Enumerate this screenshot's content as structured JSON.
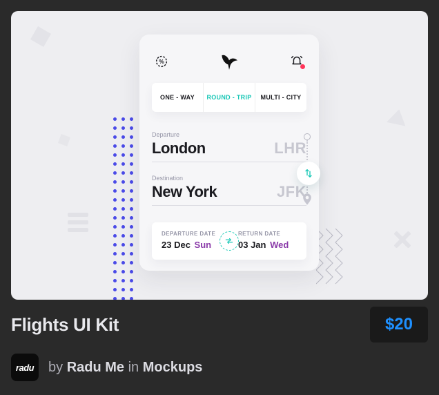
{
  "app": {
    "tabs": [
      {
        "label": "ONE - WAY",
        "active": false
      },
      {
        "label": "ROUND - TRIP",
        "active": true
      },
      {
        "label": "MULTI - CITY",
        "active": false
      }
    ],
    "departure": {
      "label": "Departure",
      "city": "London",
      "code": "LHR"
    },
    "destination": {
      "label": "Destination",
      "city": "New York",
      "code": "JFK"
    },
    "dates": {
      "dep_label": "DEPARTURE DATE",
      "dep_date": "23 Dec",
      "dep_dow": "Sun",
      "ret_label": "RETURN DATE",
      "ret_date": "03 Jan",
      "ret_dow": "Wed"
    }
  },
  "product": {
    "title": "Flights UI Kit",
    "price": "$20",
    "avatar_text": "radu",
    "by_text": "by",
    "author": "Radu Me",
    "in_text": "in",
    "category": "Mockups"
  },
  "colors": {
    "accent_teal": "#18c7b6",
    "accent_purple": "#8a3aa9",
    "price_blue": "#1e90ff",
    "alert_red": "#ff355a",
    "dot_blue": "#4a4ae8"
  }
}
